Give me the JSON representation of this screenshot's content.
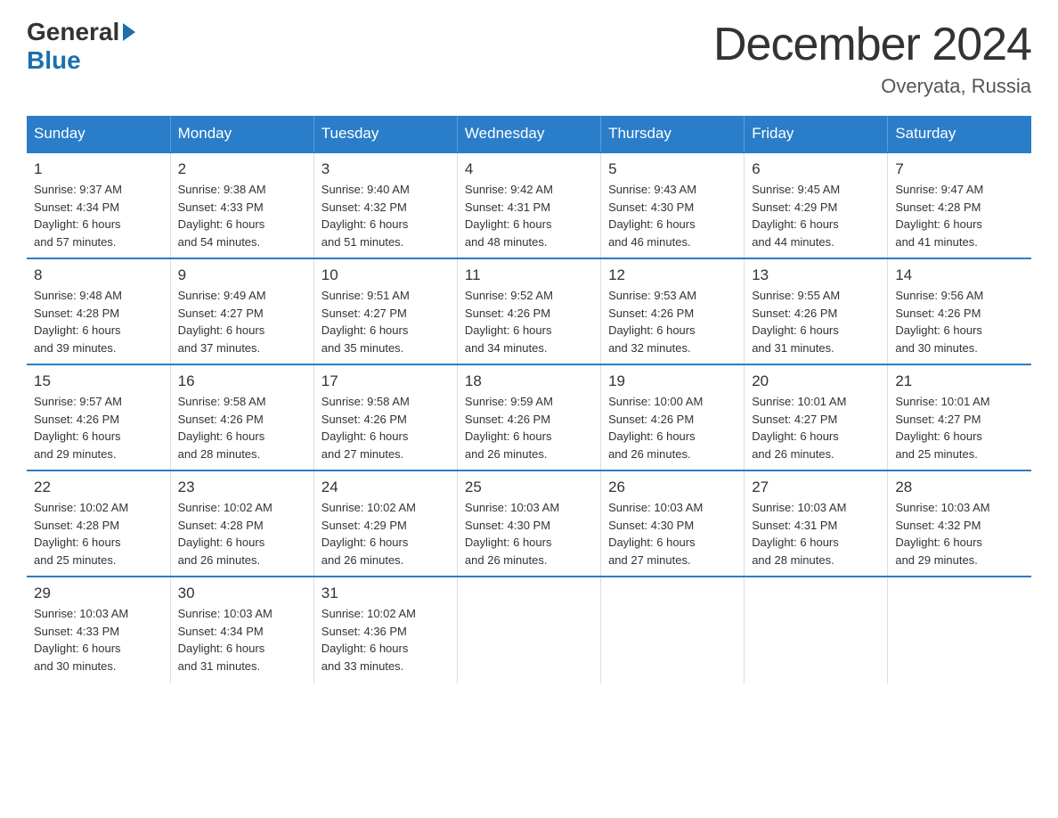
{
  "header": {
    "logo_general": "General",
    "logo_blue": "Blue",
    "main_title": "December 2024",
    "subtitle": "Overyata, Russia"
  },
  "calendar": {
    "days_of_week": [
      "Sunday",
      "Monday",
      "Tuesday",
      "Wednesday",
      "Thursday",
      "Friday",
      "Saturday"
    ],
    "weeks": [
      [
        {
          "day": "1",
          "info": "Sunrise: 9:37 AM\nSunset: 4:34 PM\nDaylight: 6 hours\nand 57 minutes."
        },
        {
          "day": "2",
          "info": "Sunrise: 9:38 AM\nSunset: 4:33 PM\nDaylight: 6 hours\nand 54 minutes."
        },
        {
          "day": "3",
          "info": "Sunrise: 9:40 AM\nSunset: 4:32 PM\nDaylight: 6 hours\nand 51 minutes."
        },
        {
          "day": "4",
          "info": "Sunrise: 9:42 AM\nSunset: 4:31 PM\nDaylight: 6 hours\nand 48 minutes."
        },
        {
          "day": "5",
          "info": "Sunrise: 9:43 AM\nSunset: 4:30 PM\nDaylight: 6 hours\nand 46 minutes."
        },
        {
          "day": "6",
          "info": "Sunrise: 9:45 AM\nSunset: 4:29 PM\nDaylight: 6 hours\nand 44 minutes."
        },
        {
          "day": "7",
          "info": "Sunrise: 9:47 AM\nSunset: 4:28 PM\nDaylight: 6 hours\nand 41 minutes."
        }
      ],
      [
        {
          "day": "8",
          "info": "Sunrise: 9:48 AM\nSunset: 4:28 PM\nDaylight: 6 hours\nand 39 minutes."
        },
        {
          "day": "9",
          "info": "Sunrise: 9:49 AM\nSunset: 4:27 PM\nDaylight: 6 hours\nand 37 minutes."
        },
        {
          "day": "10",
          "info": "Sunrise: 9:51 AM\nSunset: 4:27 PM\nDaylight: 6 hours\nand 35 minutes."
        },
        {
          "day": "11",
          "info": "Sunrise: 9:52 AM\nSunset: 4:26 PM\nDaylight: 6 hours\nand 34 minutes."
        },
        {
          "day": "12",
          "info": "Sunrise: 9:53 AM\nSunset: 4:26 PM\nDaylight: 6 hours\nand 32 minutes."
        },
        {
          "day": "13",
          "info": "Sunrise: 9:55 AM\nSunset: 4:26 PM\nDaylight: 6 hours\nand 31 minutes."
        },
        {
          "day": "14",
          "info": "Sunrise: 9:56 AM\nSunset: 4:26 PM\nDaylight: 6 hours\nand 30 minutes."
        }
      ],
      [
        {
          "day": "15",
          "info": "Sunrise: 9:57 AM\nSunset: 4:26 PM\nDaylight: 6 hours\nand 29 minutes."
        },
        {
          "day": "16",
          "info": "Sunrise: 9:58 AM\nSunset: 4:26 PM\nDaylight: 6 hours\nand 28 minutes."
        },
        {
          "day": "17",
          "info": "Sunrise: 9:58 AM\nSunset: 4:26 PM\nDaylight: 6 hours\nand 27 minutes."
        },
        {
          "day": "18",
          "info": "Sunrise: 9:59 AM\nSunset: 4:26 PM\nDaylight: 6 hours\nand 26 minutes."
        },
        {
          "day": "19",
          "info": "Sunrise: 10:00 AM\nSunset: 4:26 PM\nDaylight: 6 hours\nand 26 minutes."
        },
        {
          "day": "20",
          "info": "Sunrise: 10:01 AM\nSunset: 4:27 PM\nDaylight: 6 hours\nand 26 minutes."
        },
        {
          "day": "21",
          "info": "Sunrise: 10:01 AM\nSunset: 4:27 PM\nDaylight: 6 hours\nand 25 minutes."
        }
      ],
      [
        {
          "day": "22",
          "info": "Sunrise: 10:02 AM\nSunset: 4:28 PM\nDaylight: 6 hours\nand 25 minutes."
        },
        {
          "day": "23",
          "info": "Sunrise: 10:02 AM\nSunset: 4:28 PM\nDaylight: 6 hours\nand 26 minutes."
        },
        {
          "day": "24",
          "info": "Sunrise: 10:02 AM\nSunset: 4:29 PM\nDaylight: 6 hours\nand 26 minutes."
        },
        {
          "day": "25",
          "info": "Sunrise: 10:03 AM\nSunset: 4:30 PM\nDaylight: 6 hours\nand 26 minutes."
        },
        {
          "day": "26",
          "info": "Sunrise: 10:03 AM\nSunset: 4:30 PM\nDaylight: 6 hours\nand 27 minutes."
        },
        {
          "day": "27",
          "info": "Sunrise: 10:03 AM\nSunset: 4:31 PM\nDaylight: 6 hours\nand 28 minutes."
        },
        {
          "day": "28",
          "info": "Sunrise: 10:03 AM\nSunset: 4:32 PM\nDaylight: 6 hours\nand 29 minutes."
        }
      ],
      [
        {
          "day": "29",
          "info": "Sunrise: 10:03 AM\nSunset: 4:33 PM\nDaylight: 6 hours\nand 30 minutes."
        },
        {
          "day": "30",
          "info": "Sunrise: 10:03 AM\nSunset: 4:34 PM\nDaylight: 6 hours\nand 31 minutes."
        },
        {
          "day": "31",
          "info": "Sunrise: 10:02 AM\nSunset: 4:36 PM\nDaylight: 6 hours\nand 33 minutes."
        },
        {
          "day": "",
          "info": ""
        },
        {
          "day": "",
          "info": ""
        },
        {
          "day": "",
          "info": ""
        },
        {
          "day": "",
          "info": ""
        }
      ]
    ]
  }
}
